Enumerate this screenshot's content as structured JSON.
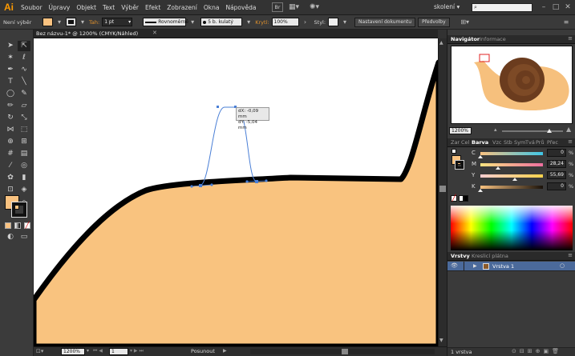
{
  "app": {
    "logo": "Ai"
  },
  "menu": [
    "Soubor",
    "Úpravy",
    "Objekt",
    "Text",
    "Výběr",
    "Efekt",
    "Zobrazení",
    "Okna",
    "Nápověda"
  ],
  "menubar_right": {
    "br": "Br",
    "workspace": "skolení",
    "search_placeholder": ""
  },
  "control": {
    "selection": "Není výběr",
    "fill_color": "#f9c280",
    "stroke_label": "Tah:",
    "stroke_weight": "1 pt",
    "profile": "Rovnoměrně",
    "brush": "5 b. kulatý",
    "opacity_label": "Krytí:",
    "opacity": "100%",
    "style_label": "Styl:",
    "doc_setup": "Nastavení dokumentu",
    "prefs": "Předvolby"
  },
  "document": {
    "tab": "Bez názvu-1* @ 1200% (CMYK/Náhled)"
  },
  "tooltip": {
    "dx": "dX: -0,09 mm",
    "dy": "dY: -5,04 mm"
  },
  "colors": {
    "shell": "#f9c37f",
    "accent": "#e0912c",
    "snail_body": "#f6c07d",
    "snail_shell": "#6b3c1e"
  },
  "status": {
    "zoom": "1200%",
    "page": "1",
    "tool": "Posunout"
  },
  "navigator": {
    "tabs": [
      "Navigátor",
      "Informace"
    ],
    "zoom": "1200%"
  },
  "color_panel": {
    "tabs": [
      "Zar",
      "Cel",
      "Barva",
      "Vzc",
      "Stb",
      "Sym",
      "Tvá",
      "Prů",
      "Přec"
    ],
    "sliders": [
      {
        "label": "C",
        "value": "0",
        "pos": 0
      },
      {
        "label": "M",
        "value": "28,24",
        "pos": 0.2824
      },
      {
        "label": "Y",
        "value": "55,69",
        "pos": 0.5569
      },
      {
        "label": "K",
        "value": "0",
        "pos": 0
      }
    ],
    "pct": "%"
  },
  "layers": {
    "tabs": [
      "Vrstvy",
      "Kreslicí plátna"
    ],
    "layer_name": "Vrstva 1",
    "footer": "1 vrstva"
  }
}
